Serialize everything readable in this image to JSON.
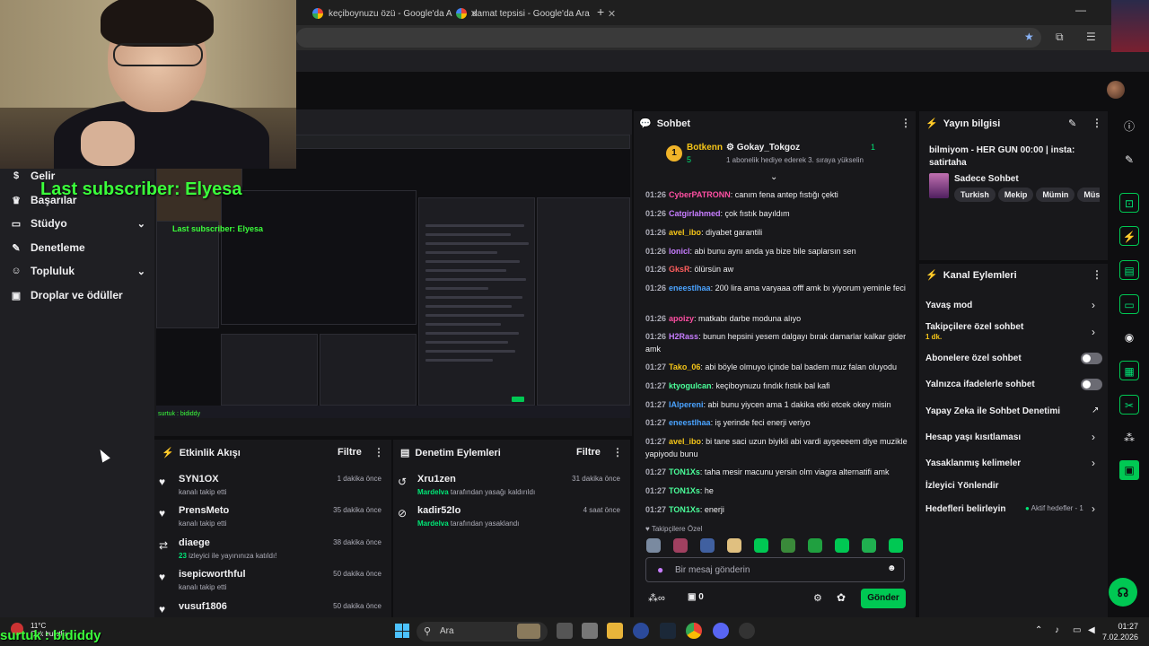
{
  "browser": {
    "tabs": [
      {
        "title": "keçiboynuzu özü - Google'da A"
      },
      {
        "title": "damat tepsisi - Google'da Ara"
      }
    ]
  },
  "overlay": {
    "last_subscriber": "Last subscriber: Elyesa",
    "bottom_text": "surtuk : bididdy"
  },
  "nav": {
    "items": [
      {
        "label": "Gelir",
        "icon": "dollar-icon"
      },
      {
        "label": "Başarılar",
        "icon": "trophy-icon"
      },
      {
        "label": "Stüdyo",
        "icon": "monitor-icon",
        "expandable": true
      },
      {
        "label": "Denetleme",
        "icon": "wrench-icon"
      },
      {
        "label": "Topluluk",
        "icon": "people-icon",
        "expandable": true
      },
      {
        "label": "Droplar ve ödüller",
        "icon": "gift-icon"
      }
    ]
  },
  "activity": {
    "title": "Etkinlik Akışı",
    "filter_label": "Filtre",
    "events": [
      {
        "name": "SYN1OX",
        "sub": "kanalı takip etti",
        "time": "1 dakika önce",
        "icon": "heart-icon"
      },
      {
        "name": "PrensMeto",
        "sub": "kanalı takip etti",
        "time": "35 dakika önce",
        "icon": "heart-icon"
      },
      {
        "name": "diaege",
        "sub_highlight": "23",
        "sub": " izleyici ile yayınınıza katıldı!",
        "time": "38 dakika önce",
        "icon": "raid-icon"
      },
      {
        "name": "isepicworthful",
        "sub": "kanalı takip etti",
        "time": "50 dakika önce",
        "icon": "heart-icon"
      },
      {
        "name": "vusuf1806",
        "sub": "",
        "time": "50 dakika önce",
        "icon": "heart-icon"
      }
    ]
  },
  "moderation": {
    "title": "Denetim Eylemleri",
    "filter_label": "Filtre",
    "events": [
      {
        "name": "Xru1zen",
        "by": "Mardelva",
        "sub": " tarafından yasağı kaldırıldı",
        "time": "31 dakika önce",
        "icon": "unban-icon"
      },
      {
        "name": "kadir52lo",
        "by": "Mardelva",
        "sub": " tarafından yasaklandı",
        "time": "4 saat önce",
        "icon": "ban-icon"
      }
    ]
  },
  "chat": {
    "title": "Sohbet",
    "leaderboard": {
      "first_rank": "1",
      "first_name": "Botkenn",
      "first_value": "5",
      "second_name": "Gokay_Tokgoz",
      "second_value": "1",
      "second_note": "1 abonelik hediye ederek 3. sıraya yükselin"
    },
    "messages": [
      {
        "time": "01:26",
        "user": "CyberPATRONN",
        "color": "#ff4fa3",
        "text": ": canım fena antep fıstığı çekti"
      },
      {
        "time": "01:26",
        "user": "Catgirlahmed",
        "color": "#c77dff",
        "text": ": çok fıstık bayıldım"
      },
      {
        "time": "01:26",
        "user": "avel_ibo",
        "color": "#f5c518",
        "text": ": diyabet garantili"
      },
      {
        "time": "01:26",
        "user": "lonicl",
        "color": "#c77dff",
        "text": ": abi bunu aynı anda ya bize bile saplarsın sen"
      },
      {
        "time": "01:26",
        "user": "GksR",
        "color": "#ff5e5e",
        "text": ": ölürsün aw"
      },
      {
        "time": "01:26",
        "user": "eneestlhaa",
        "color": "#4aa3ff",
        "text": ": 200 lira ama varyaaa offf amk bı yiyorum yeminle feci"
      },
      {
        "time": "01:26",
        "user": "apoizy",
        "color": "#ff4fa3",
        "text": ": matkabı darbe moduna alıyo"
      },
      {
        "time": "01:26",
        "user": "H2Rass",
        "color": "#c77dff",
        "text": ": bunun hepsini yesem dalgayı bırak damarlar kalkar gider amk"
      },
      {
        "time": "01:27",
        "user": "Tako_06",
        "color": "#f5c518",
        "text": ": abi böyle olmuyo içinde bal badem muz falan oluyodu"
      },
      {
        "time": "01:27",
        "user": "ktyogulcan",
        "color": "#4aff9a",
        "text": ": keçiboynuzu fındık fıstık bal kafi"
      },
      {
        "time": "01:27",
        "user": "lAlpereni",
        "color": "#4aa3ff",
        "text": ": abi bunu yiycen ama 1 dakika etki etcek okey misin"
      },
      {
        "time": "01:27",
        "user": "eneestlhaa",
        "color": "#4aa3ff",
        "text": ": iş yerinde feci enerji veriyo"
      },
      {
        "time": "01:27",
        "user": "avel_ibo",
        "color": "#f5c518",
        "text": ": bi tane saci uzun biyikli abi vardi ayşeeeem diye muzikle yapiyodu bunu"
      },
      {
        "time": "01:27",
        "user": "TON1Xs",
        "color": "#4aff9a",
        "text": ": taha mesir macunu yersin olm viagra alternatifi amk"
      },
      {
        "time": "01:27",
        "user": "TON1Xs",
        "color": "#4aff9a",
        "text": ": he"
      },
      {
        "time": "01:27",
        "user": "TON1Xs",
        "color": "#4aff9a",
        "text": ": enerji"
      }
    ],
    "followers_only_label": "Takipçilere Özel",
    "input_placeholder": "Bir mesaj gönderin",
    "points_value": "0",
    "send_label": "Gönder"
  },
  "stream_info": {
    "title": "Yayın bilgisi",
    "stream_title": "bilmiyom - HER GUN 00:00 | insta: satirtaha",
    "category": "Sadece Sohbet",
    "tags": [
      "Turkish",
      "Mekip",
      "Mümin",
      "Müs"
    ]
  },
  "channel_actions": {
    "title": "Kanal Eylemleri",
    "items": [
      {
        "label": "Yavaş mod",
        "control": "arrow"
      },
      {
        "label": "Takipçilere özel sohbet",
        "sub": "1 dk.",
        "control": "arrow"
      },
      {
        "label": "Abonelere özel sohbet",
        "control": "toggle"
      },
      {
        "label": "Yalnızca ifadelerle sohbet",
        "control": "toggle"
      },
      {
        "label": "Yapay Zeka ile Sohbet Denetimi",
        "control": "external"
      },
      {
        "label": "Hesap yaşı kısıtlaması",
        "control": "arrow"
      },
      {
        "label": "Yasaklanmış kelimeler",
        "control": "arrow"
      },
      {
        "label": "İzleyici Yönlendir",
        "control": "none"
      },
      {
        "label": "Hedefleri belirleyin",
        "status": "Aktif hedefler - 1",
        "control": "arrow"
      }
    ]
  },
  "taskbar": {
    "search_placeholder": "Ara",
    "weather_temp": "11°C",
    "weather_text": "Çok bulutlu",
    "time": "01:27",
    "date": "7.02.2026"
  },
  "colors": {
    "accent": "#00c853",
    "bg": "#0e0e10",
    "panel": "#18181b"
  }
}
